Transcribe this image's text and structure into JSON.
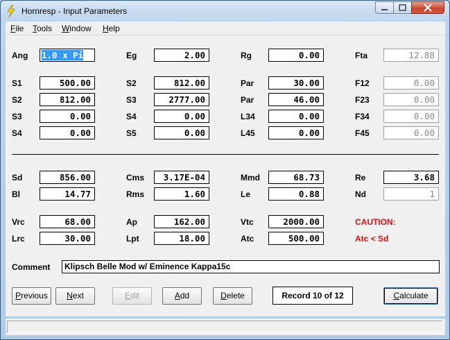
{
  "window": {
    "title": "Hornresp - Input Parameters"
  },
  "menu": [
    {
      "label": "File",
      "accel": "F",
      "rest": "ile"
    },
    {
      "label": "Tools",
      "accel": "T",
      "rest": "ools"
    },
    {
      "label": "Window",
      "accel": "W",
      "rest": "indow"
    },
    {
      "label": "Help",
      "accel": "H",
      "rest": "elp"
    }
  ],
  "params": {
    "ang": {
      "label": "Ang",
      "value": "1.0 x Pi"
    },
    "eg": {
      "label": "Eg",
      "value": "2.00"
    },
    "rg": {
      "label": "Rg",
      "value": "0.00"
    },
    "fta": {
      "label": "Fta",
      "value": "12.88"
    },
    "s1": {
      "label": "S1",
      "value": "500.00"
    },
    "s2a": {
      "label": "S2",
      "value": "812.00"
    },
    "par1": {
      "label": "Par",
      "value": "30.00"
    },
    "f12": {
      "label": "F12",
      "value": "0.00"
    },
    "s2b": {
      "label": "S2",
      "value": "812.00"
    },
    "s3a": {
      "label": "S3",
      "value": "2777.00"
    },
    "par2": {
      "label": "Par",
      "value": "46.00"
    },
    "f23": {
      "label": "F23",
      "value": "0.00"
    },
    "s3b": {
      "label": "S3",
      "value": "0.00"
    },
    "s4a": {
      "label": "S4",
      "value": "0.00"
    },
    "l34": {
      "label": "L34",
      "value": "0.00"
    },
    "f34": {
      "label": "F34",
      "value": "0.00"
    },
    "s4b": {
      "label": "S4",
      "value": "0.00"
    },
    "s5": {
      "label": "S5",
      "value": "0.00"
    },
    "l45": {
      "label": "L45",
      "value": "0.00"
    },
    "f45": {
      "label": "F45",
      "value": "0.00"
    },
    "sd": {
      "label": "Sd",
      "value": "856.00"
    },
    "cms": {
      "label": "Cms",
      "value": "3.17E-04"
    },
    "mmd": {
      "label": "Mmd",
      "value": "68.73"
    },
    "re": {
      "label": "Re",
      "value": "3.68"
    },
    "bl": {
      "label": "Bl",
      "value": "14.77"
    },
    "rms": {
      "label": "Rms",
      "value": "1.60"
    },
    "le": {
      "label": "Le",
      "value": "0.88"
    },
    "nd": {
      "label": "Nd",
      "value": "1"
    },
    "vrc": {
      "label": "Vrc",
      "value": "68.00"
    },
    "ap": {
      "label": "Ap",
      "value": "162.00"
    },
    "vtc": {
      "label": "Vtc",
      "value": "2000.00"
    },
    "lrc": {
      "label": "Lrc",
      "value": "30.00"
    },
    "lpt": {
      "label": "Lpt",
      "value": "18.00"
    },
    "atc": {
      "label": "Atc",
      "value": "500.00"
    }
  },
  "caution": {
    "title": "CAUTION:",
    "message": "Atc < Sd",
    "color": "#e01010"
  },
  "comment": {
    "label": "Comment",
    "value": "Klipsch Belle Mod w/ Eminence Kappa15c"
  },
  "buttons": {
    "previous": {
      "accel": "P",
      "rest": "revious"
    },
    "next": {
      "accel": "N",
      "rest": "ext"
    },
    "edit": {
      "accel": "E",
      "rest": "dit"
    },
    "add": {
      "accel": "A",
      "rest": "dd"
    },
    "delete": {
      "accel": "D",
      "rest": "elete"
    },
    "calculate": {
      "accel": "C",
      "rest": "alculate"
    }
  },
  "record": "Record 10 of 12",
  "icons": {
    "app": "lightning-bolt-icon",
    "min": "minimize-icon",
    "max": "maximize-icon",
    "close": "close-icon"
  }
}
